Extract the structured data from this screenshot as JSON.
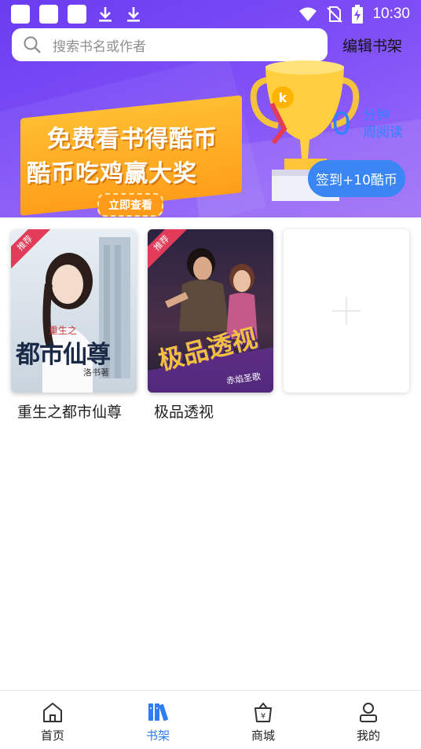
{
  "status_bar": {
    "time": "10:30"
  },
  "search": {
    "placeholder": "搜索书名或作者"
  },
  "header": {
    "edit_shelf_label": "编辑书架"
  },
  "banner": {
    "line1": "免费看书得酷币",
    "line2": "酷币吃鸡赢大奖",
    "cta": "立即查看"
  },
  "reading": {
    "count": "0",
    "unit_line1": "分钟",
    "unit_line2": "周阅读"
  },
  "checkin": {
    "label": "签到+10酷币"
  },
  "books": [
    {
      "title": "重生之都市仙尊",
      "tag": "推荐",
      "cover_title": "都市仙尊",
      "cover_subtitle": "重生之",
      "cover_author": "洛书著"
    },
    {
      "title": "极品透视",
      "tag": "推荐",
      "cover_title": "极品透视",
      "cover_author": "赤焰圣歌"
    }
  ],
  "bottom_nav": [
    {
      "label": "首页",
      "icon": "home-icon",
      "active": false
    },
    {
      "label": "书架",
      "icon": "bookshelf-icon",
      "active": true
    },
    {
      "label": "商城",
      "icon": "store-icon",
      "active": false
    },
    {
      "label": "我的",
      "icon": "profile-icon",
      "active": false
    }
  ],
  "colors": {
    "accent": "#2f7cf6",
    "banner_purple": "#7c4cf6",
    "tag_red": "#e23c5a",
    "promo_orange": "#ffa41f"
  }
}
